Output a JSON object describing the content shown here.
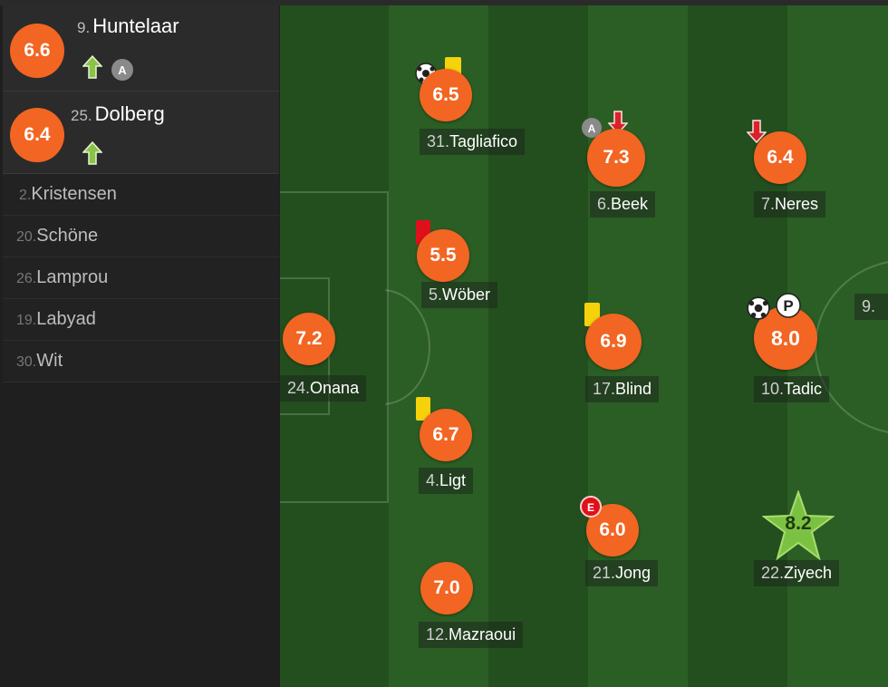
{
  "subs": [
    {
      "number": "9.",
      "name": "Huntelaar",
      "rating": "6.6",
      "icons": [
        "sub-in-arrow-icon",
        "assist-icon"
      ]
    },
    {
      "number": "25.",
      "name": "Dolberg",
      "rating": "6.4",
      "icons": [
        "sub-in-arrow-icon"
      ]
    }
  ],
  "bench": [
    {
      "number": "2.",
      "name": "Kristensen"
    },
    {
      "number": "20.",
      "name": "Schöne"
    },
    {
      "number": "26.",
      "name": "Lamprou"
    },
    {
      "number": "19.",
      "name": "Labyad"
    },
    {
      "number": "30.",
      "name": "Wit"
    }
  ],
  "players": [
    {
      "key": "onana",
      "number": "24.",
      "name": "Onana",
      "rating": "7.2"
    },
    {
      "key": "tagliafico",
      "number": "31.",
      "name": "Tagliafico",
      "rating": "6.5",
      "icons": [
        "goal-ball-icon",
        "yellow-card-icon"
      ]
    },
    {
      "key": "wober",
      "number": "5.",
      "name": "Wöber",
      "rating": "5.5",
      "icons": [
        "red-card-icon"
      ]
    },
    {
      "key": "ligt",
      "number": "4.",
      "name": "Ligt",
      "rating": "6.7",
      "icons": [
        "yellow-card-icon"
      ]
    },
    {
      "key": "mazraoui",
      "number": "12.",
      "name": "Mazraoui",
      "rating": "7.0"
    },
    {
      "key": "beek",
      "number": "6.",
      "name": "Beek",
      "rating": "7.3",
      "icons": [
        "assist-icon",
        "sub-out-arrow-icon"
      ]
    },
    {
      "key": "blind",
      "number": "17.",
      "name": "Blind",
      "rating": "6.9",
      "icons": [
        "yellow-card-icon"
      ]
    },
    {
      "key": "jong",
      "number": "21.",
      "name": "Jong",
      "rating": "6.0",
      "icons": [
        "error-icon"
      ]
    },
    {
      "key": "neres",
      "number": "7.",
      "name": "Neres",
      "rating": "6.4",
      "icons": [
        "sub-out-arrow-icon"
      ]
    },
    {
      "key": "tadic",
      "number": "10.",
      "name": "Tadic",
      "rating": "8.0",
      "icons": [
        "goal-ball-icon",
        "penalty-icon"
      ]
    },
    {
      "key": "ziyech",
      "number": "22.",
      "name": "Ziyech",
      "rating": "8.2",
      "icons": [
        "man-of-the-match-star-icon"
      ]
    },
    {
      "key": "partial",
      "number": "9.",
      "name": ""
    }
  ],
  "colors": {
    "rating": "#f26522",
    "star": "#7cc242",
    "pitch_dark": "#234f1e",
    "pitch_light": "#2b5e24"
  }
}
